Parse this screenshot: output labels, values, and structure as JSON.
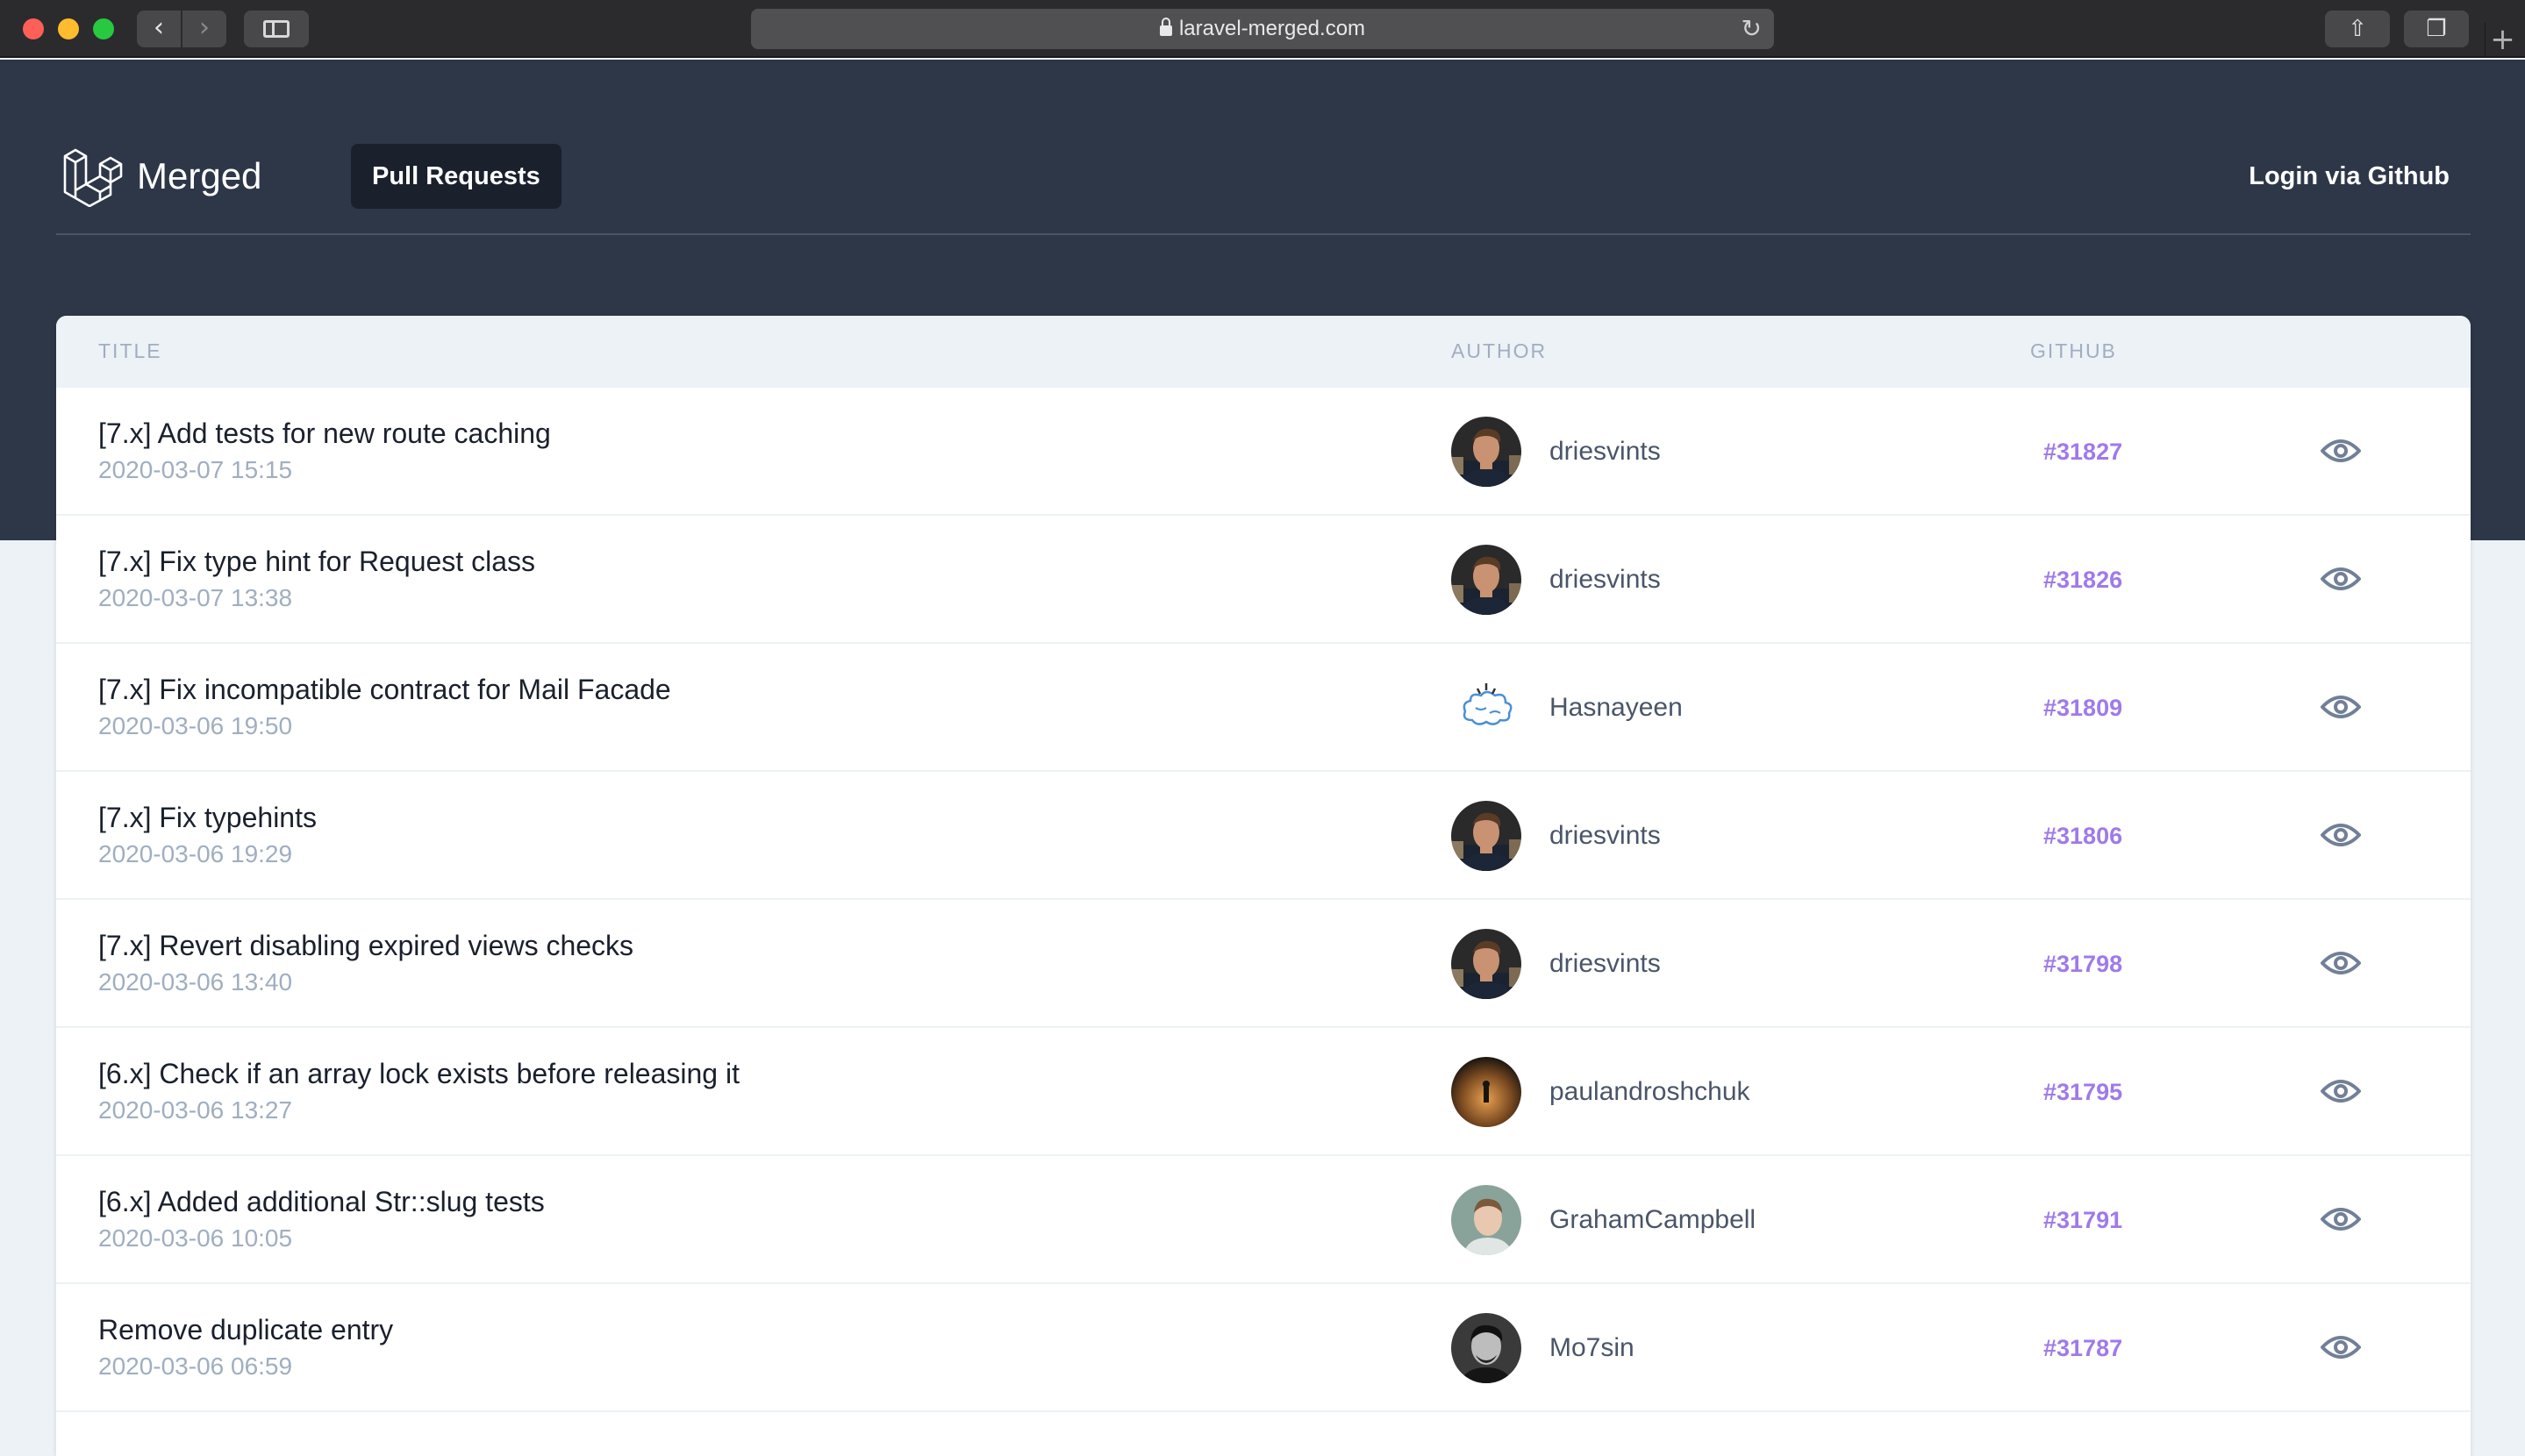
{
  "browser": {
    "url": "laravel-merged.com",
    "back_glyph": "‹",
    "forward_glyph": "›",
    "reload_glyph": "↻",
    "share_glyph": "⇧",
    "tabs_glyph": "❐",
    "newtab_glyph": "+"
  },
  "header": {
    "brand": "Merged",
    "nav_pull_requests": "Pull Requests",
    "login": "Login via Github"
  },
  "table": {
    "columns": {
      "title": "Title",
      "author": "Author",
      "github": "Github"
    },
    "rows": [
      {
        "title": "[7.x] Add tests for new route caching",
        "date": "2020-03-07 15:15",
        "author": "driesvints",
        "pr": "#31827",
        "avatar": "driesvints"
      },
      {
        "title": "[7.x] Fix type hint for Request class",
        "date": "2020-03-07 13:38",
        "author": "driesvints",
        "pr": "#31826",
        "avatar": "driesvints"
      },
      {
        "title": "[7.x] Fix incompatible contract for Mail Facade",
        "date": "2020-03-06 19:50",
        "author": "Hasnayeen",
        "pr": "#31809",
        "avatar": "hasnayeen"
      },
      {
        "title": "[7.x] Fix typehints",
        "date": "2020-03-06 19:29",
        "author": "driesvints",
        "pr": "#31806",
        "avatar": "driesvints"
      },
      {
        "title": "[7.x] Revert disabling expired views checks",
        "date": "2020-03-06 13:40",
        "author": "driesvints",
        "pr": "#31798",
        "avatar": "driesvints"
      },
      {
        "title": "[6.x] Check if an array lock exists before releasing it",
        "date": "2020-03-06 13:27",
        "author": "paulandroshchuk",
        "pr": "#31795",
        "avatar": "paulandroshchuk"
      },
      {
        "title": "[6.x] Added additional Str::slug tests",
        "date": "2020-03-06 10:05",
        "author": "GrahamCampbell",
        "pr": "#31791",
        "avatar": "grahamcampbell"
      },
      {
        "title": "Remove duplicate entry",
        "date": "2020-03-06 06:59",
        "author": "Mo7sin",
        "pr": "#31787",
        "avatar": "mo7sin"
      }
    ]
  },
  "colors": {
    "hero_bg": "#2d3748",
    "link_purple": "#9f7aea",
    "muted": "#a0aec0"
  }
}
